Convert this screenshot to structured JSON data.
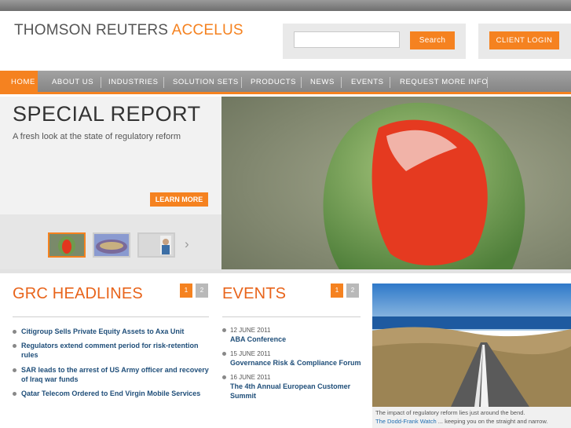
{
  "brand": {
    "name_main": "THOMSON REUTERS",
    "name_accent": "ACCELUS"
  },
  "search": {
    "placeholder": "",
    "button_label": "Search"
  },
  "login": {
    "label": "CLIENT LOGIN"
  },
  "nav": {
    "items": [
      {
        "label": "HOME",
        "active": true
      },
      {
        "label": "ABOUT US"
      },
      {
        "label": "INDUSTRIES"
      },
      {
        "label": "SOLUTION SETS"
      },
      {
        "label": "PRODUCTS"
      },
      {
        "label": "NEWS"
      },
      {
        "label": "EVENTS"
      },
      {
        "label": "REQUEST MORE INFO"
      }
    ]
  },
  "hero": {
    "title": "SPECIAL REPORT",
    "subtitle": "A fresh look at the state of regulatory reform",
    "cta_label": "LEARN MORE",
    "thumbnails": [
      "flower",
      "stadium",
      "portrait"
    ]
  },
  "headlines": {
    "title": "GRC HEADLINES",
    "pages": [
      "1",
      "2"
    ],
    "items": [
      "Citigroup Sells Private Equity Assets to Axa Unit",
      "Regulators extend comment period for risk-retention rules",
      "SAR leads to the arrest of US Army officer and recovery of Iraq war funds",
      "Qatar Telecom Ordered to End Virgin Mobile Services"
    ]
  },
  "events": {
    "title": "EVENTS",
    "pages": [
      "1",
      "2"
    ],
    "items": [
      {
        "date": "12 JUNE 2011",
        "title": "ABA Conference"
      },
      {
        "date": "15 JUNE 2011",
        "title": "Governance Risk & Compliance Forum"
      },
      {
        "date": "16 JUNE 2011",
        "title": "The 4th Annual European Customer Summit"
      }
    ]
  },
  "side": {
    "caption_line1": "The impact of regulatory reform lies just around the bend.",
    "caption_link": "The Dodd-Frank Watch",
    "caption_rest": " ... keeping you on the straight and narrow."
  },
  "colors": {
    "accent": "#f58220",
    "link": "#1f4e79",
    "section_title": "#e8641b"
  },
  "icons": {
    "thumb_next": "chevron-right-icon",
    "bullet": "bullet-icon"
  }
}
